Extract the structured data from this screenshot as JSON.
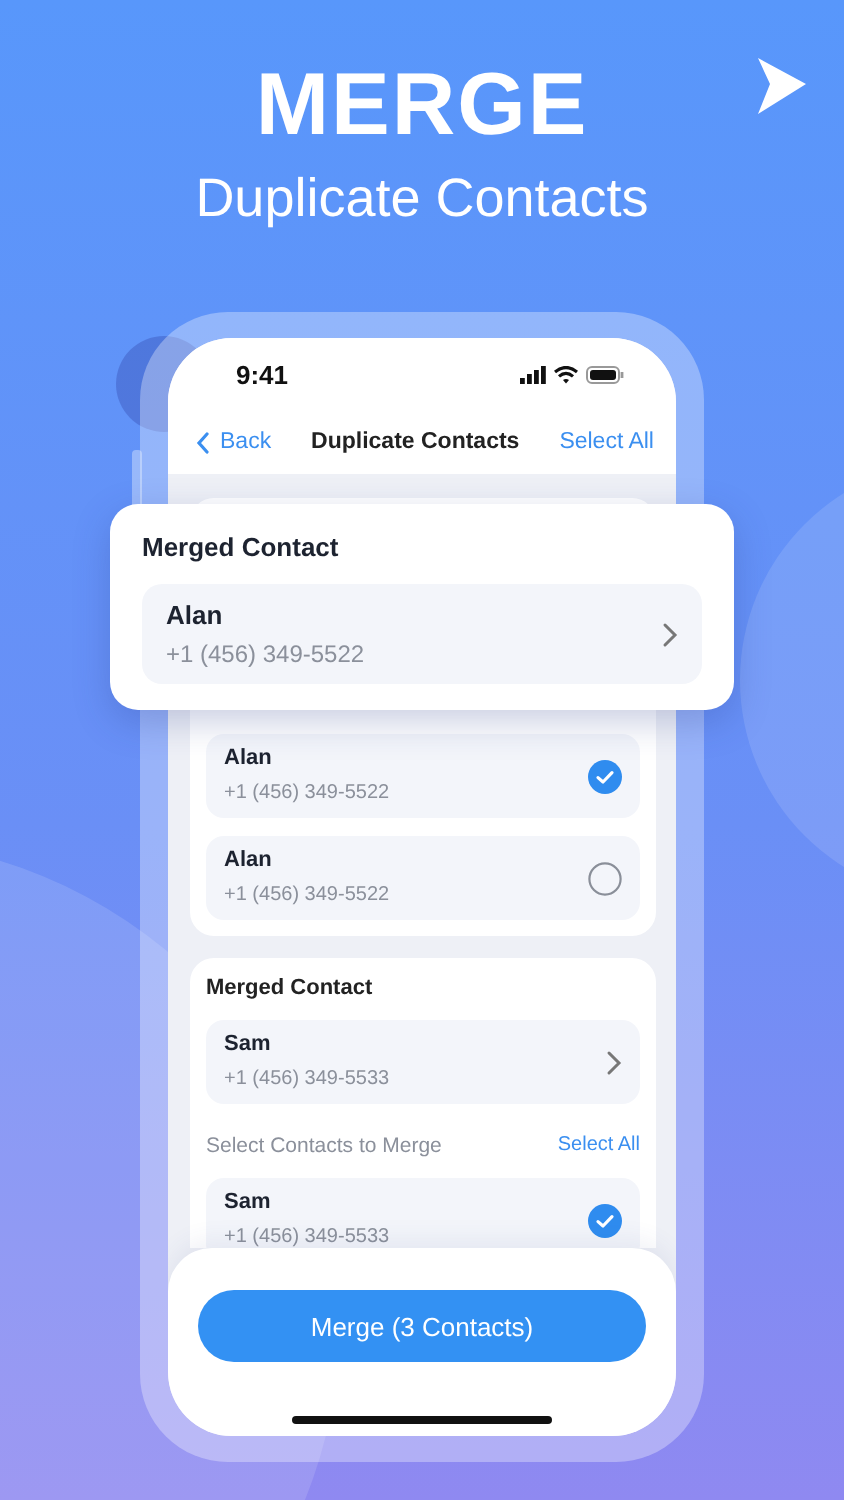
{
  "headline": {
    "title": "MERGE",
    "subtitle": "Duplicate Contacts"
  },
  "status_bar": {
    "time": "9:41"
  },
  "nav": {
    "back": "Back",
    "title": "Duplicate Contacts",
    "action": "Select All"
  },
  "featured": {
    "title": "Merged Contact",
    "contact": {
      "name": "Alan",
      "phone": "+1 (456) 349-5522"
    }
  },
  "groups": [
    {
      "contacts": [
        {
          "name": "Alan",
          "phone": "+1 (456) 349-5522",
          "selected": true
        },
        {
          "name": "Alan",
          "phone": "+1 (456) 349-5522",
          "selected": false
        }
      ]
    },
    {
      "merged_title": "Merged Contact",
      "merged": {
        "name": "Sam",
        "phone": "+1 (456) 349-5533"
      },
      "select_label": "Select Contacts to Merge",
      "select_all": "Select All",
      "contacts": [
        {
          "name": "Sam",
          "phone": "+1 (456) 349-5533",
          "selected": true
        }
      ]
    }
  ],
  "merge_button": "Merge (3 Contacts)"
}
